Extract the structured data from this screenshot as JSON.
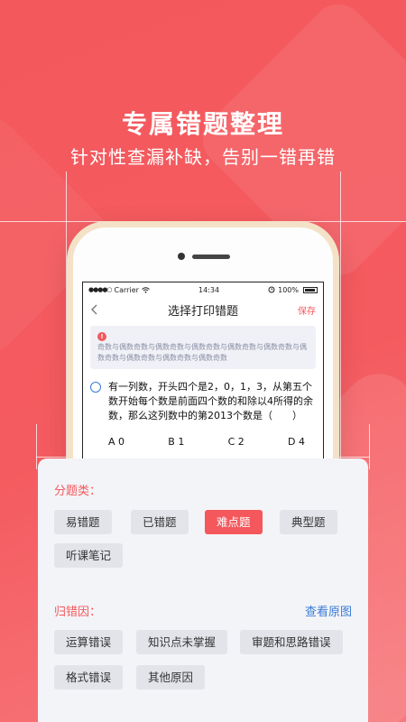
{
  "hero": {
    "title": "专属错题整理",
    "subtitle": "针对性查漏补缺，告别一错再错"
  },
  "status_bar": {
    "signal": "●●●●○",
    "carrier": "Carrier",
    "wifi_icon": "wifi-icon",
    "time": "14:34",
    "alarm_icon": "alarm-icon",
    "battery": "100%"
  },
  "nav": {
    "back_icon": "chevron-left-icon",
    "title": "选择打印错题",
    "save": "保存"
  },
  "notice": {
    "icon": "!",
    "text": "奇数与偶数奇数与偶数奇数与偶数奇数与偶数奇数与偶数奇数与偶数奇数与偶数奇数与偶数奇数与偶数奇数"
  },
  "question": {
    "text": "有一列数，开头四个是2，0，1，3，从第五个数开始每个数是前面四个数的和除以4所得的余数，那么这列数中的第2013个数是（　　）",
    "options": [
      "A 0",
      "B 1",
      "C 2",
      "D 4"
    ]
  },
  "category": {
    "label": "分题类：",
    "tags": [
      "易错题",
      "已错题",
      "难点题",
      "典型题",
      "听课笔记"
    ],
    "selected_index": 2
  },
  "reason": {
    "label": "归错因：",
    "link": "查看原图",
    "tags": [
      "运算错误",
      "知识点未掌握",
      "审题和思路错误",
      "格式错误",
      "其他原因"
    ]
  },
  "colors": {
    "accent": "#f4585c",
    "link": "#3a7bd5"
  }
}
